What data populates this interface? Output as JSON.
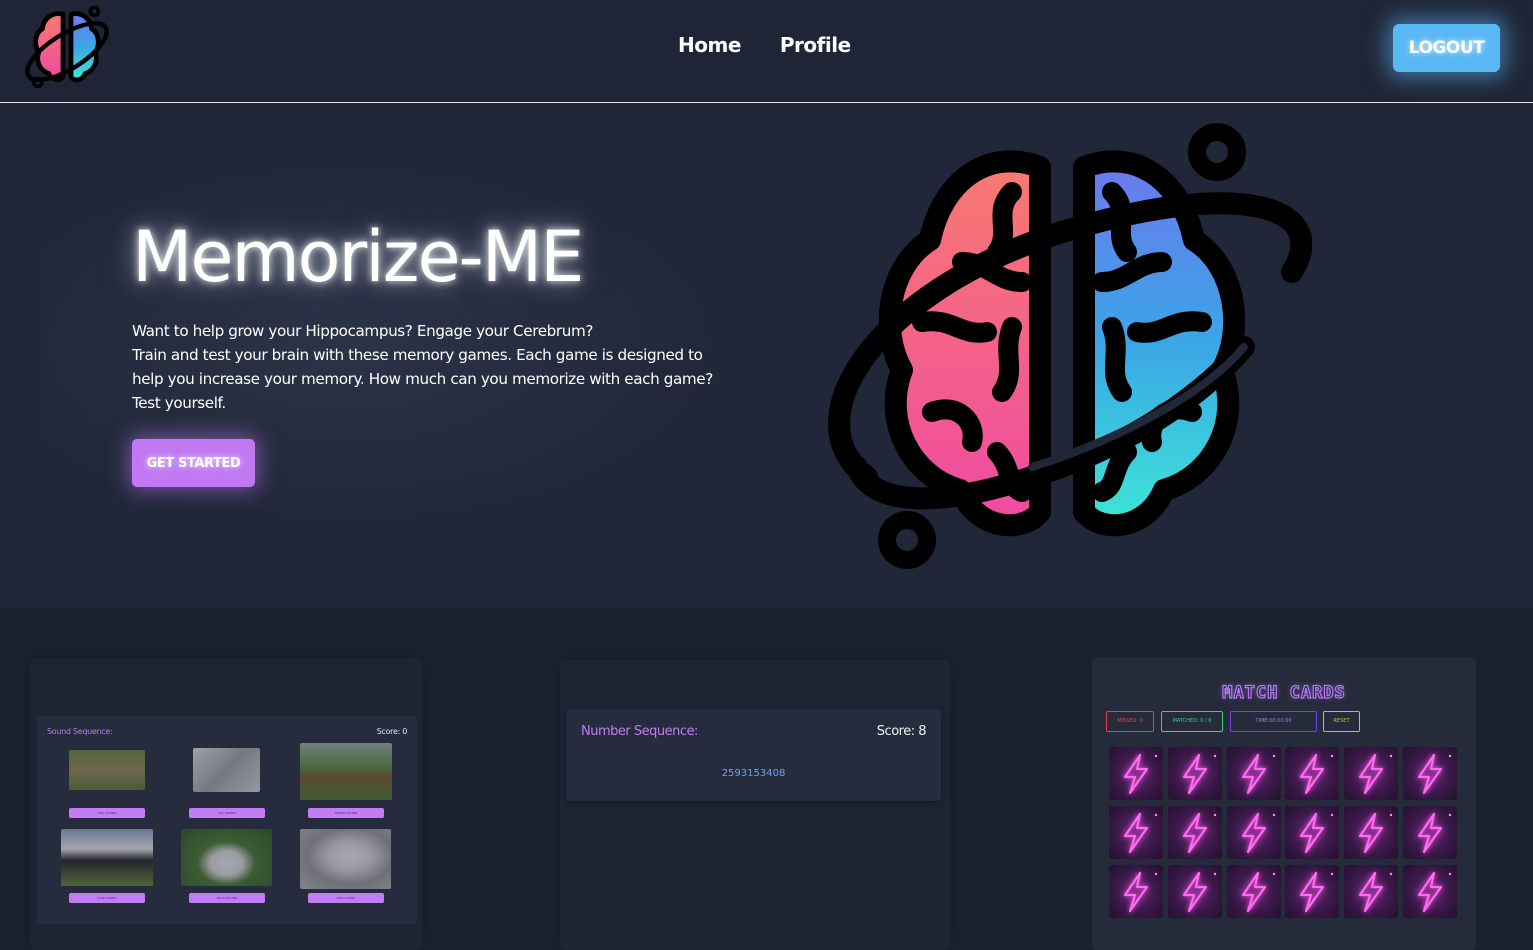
{
  "nav": {
    "links": [
      "Home",
      "Profile"
    ],
    "logout_label": "LOGOUT"
  },
  "hero": {
    "title": "Memorize-ME",
    "desc_line1": "Want to help grow your Hippocampus? Engage your Cerebrum?",
    "desc_line2": "Train and test your brain with these memory games. Each game is designed to help you increase your memory. How much can you memorize with each game? Test yourself.",
    "cta_label": "GET STARTED"
  },
  "sound_game": {
    "title": "Sound Sequence:",
    "score": "Score: 0",
    "buttons": [
      "DOG SOUND",
      "CAT SOUND",
      "HORSE SOUND",
      "COW SOUND",
      "DUCK SOUND",
      "OWL SOUND"
    ]
  },
  "number_game": {
    "title": "Number Sequence:",
    "score": "Score: 8",
    "sequence": "2593153408"
  },
  "match_game": {
    "title": "MATCH CARDS",
    "missed": "MISSED: 0",
    "matched": "MATCHED: 0 / 0",
    "time": "TIME:00:00:00",
    "reset": "RESET"
  },
  "colors": {
    "background": "#1f2536",
    "accent_purple": "#c079f3",
    "accent_blue": "#5ab8f5",
    "number_blue": "#60a8f0"
  },
  "icons": [
    "brain-planet-logo-icon",
    "lightning-icon"
  ]
}
